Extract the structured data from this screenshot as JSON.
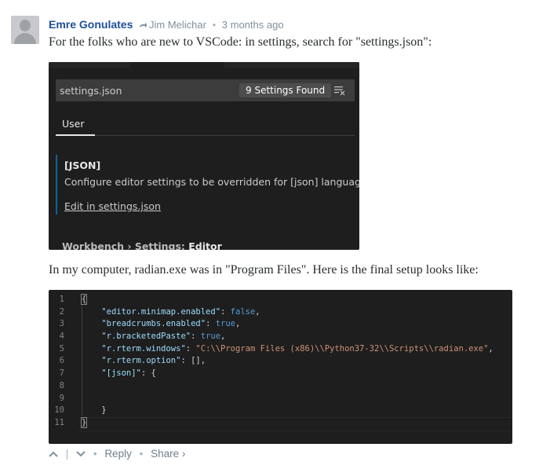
{
  "comment": {
    "author": "Emre Gonulates",
    "reply_to": "Jim Melichar",
    "time": "3 months ago",
    "text1": "For the folks who are new to VSCode: in settings, search for \"settings.json\":",
    "text2": "In my computer, radian.exe was in \"Program Files\". Here is the final setup looks like:"
  },
  "settings_ui": {
    "search_value": "settings.json",
    "results_badge": "9 Settings Found",
    "tab": "User",
    "setting_title": "[JSON]",
    "setting_desc": "Configure editor settings to be overridden for [json] language.",
    "setting_link": "Edit in settings.json",
    "section_prefix": "Workbench › Settings: ",
    "section_name": "Editor",
    "accent_color": "#0e639c"
  },
  "code_editor": {
    "line_numbers": [
      "1",
      "2",
      "3",
      "4",
      "5",
      "6",
      "7",
      "8",
      "9",
      "10",
      "11"
    ],
    "lines": [
      "{",
      "    \"editor.minimap.enabled\": false,",
      "    \"breadcrumbs.enabled\": true,",
      "    \"r.bracketedPaste\": true,",
      "    \"r.rterm.windows\": \"C:\\\\Program Files (x86)\\\\Python37-32\\\\Scripts\\\\radian.exe\",",
      "    \"r.rterm.option\": [],",
      "    \"[json]\": {",
      "",
      "",
      "    }",
      "}"
    ]
  },
  "actions": {
    "reply": "Reply",
    "share": "Share ›",
    "upvote": "chevron-up-icon",
    "downvote": "chevron-down-icon"
  }
}
